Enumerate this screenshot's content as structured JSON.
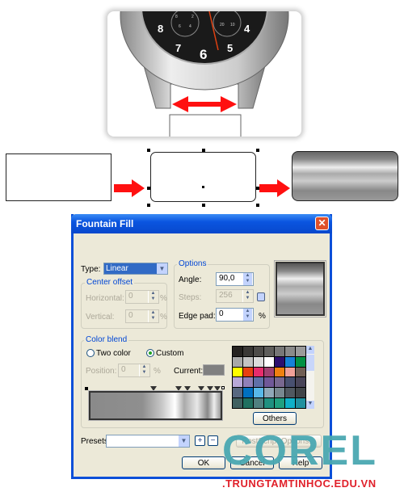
{
  "watch": {
    "numerals": [
      "8",
      "7",
      "6",
      "5",
      "4"
    ],
    "subdial_left": [
      "8",
      "2",
      "6",
      "4"
    ],
    "subdial_right": [
      "20",
      "10"
    ]
  },
  "dialog": {
    "title": "Fountain Fill",
    "type_label": "Type:",
    "type_value": "Linear",
    "center_offset": {
      "label": "Center offset",
      "horizontal_label": "Horizontal:",
      "horizontal_value": "0",
      "vertical_label": "Vertical:",
      "vertical_value": "0",
      "unit": "%"
    },
    "options": {
      "label": "Options",
      "angle_label": "Angle:",
      "angle_value": "90,0",
      "steps_label": "Steps:",
      "steps_value": "256",
      "edge_pad_label": "Edge pad:",
      "edge_pad_value": "0",
      "unit": "%"
    },
    "color_blend": {
      "label": "Color blend",
      "two_color": "Two color",
      "custom": "Custom",
      "selected": "Custom",
      "position_label": "Position:",
      "position_value": "0",
      "unit": "%",
      "current_label": "Current:",
      "current_color": "#808080",
      "others": "Others",
      "palette": [
        "#252220",
        "#3a3836",
        "#4d4b49",
        "#5f5e5c",
        "#777777",
        "#8a8a8a",
        "#9a9a9a",
        "#a8a8a8",
        "#c3c3c3",
        "#dcdcdc",
        "#ffffff",
        "#2c0f6e",
        "#1681d8",
        "#009045",
        "#ffff00",
        "#e84010",
        "#e82c6c",
        "#a04070",
        "#f08010",
        "#f0a098",
        "#705e54",
        "#b8a8d8",
        "#9080b8",
        "#6070a8",
        "#705898",
        "#786890",
        "#485070",
        "#484458",
        "#586880",
        "#0070c0",
        "#58b8e8",
        "#90a8b8",
        "#788890",
        "#505860",
        "#404448",
        "#406060",
        "#207060",
        "#508080",
        "#209080",
        "#20a080",
        "#10b0c8",
        "#2090a0"
      ]
    },
    "presets_label": "Presets:",
    "presets_value": "",
    "postscript": "PostScript Options...",
    "ok": "OK",
    "cancel": "Cancel",
    "help": "Help"
  },
  "watermark": {
    "logo": "COREL",
    "site": ".TRUNGTAMTINHOC.EDU.VN"
  },
  "colors": {
    "arrow": "#ff1010",
    "title_bar": "#0a55e0",
    "logo": "#4aa8b2"
  }
}
